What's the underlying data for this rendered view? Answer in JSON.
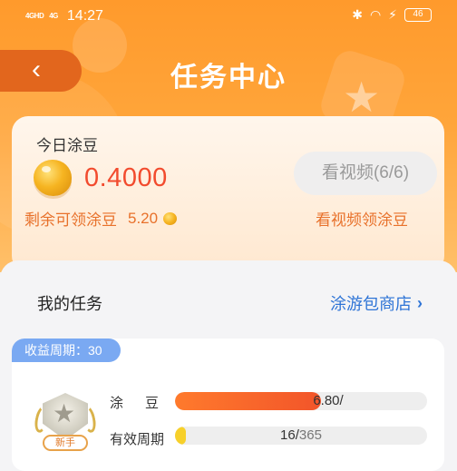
{
  "status_bar": {
    "signal_1": "4GHD",
    "signal_2": "4G",
    "time": "14:27",
    "battery": "46",
    "icons": [
      "bluetooth-icon",
      "wifi-icon",
      "charging-icon"
    ]
  },
  "header": {
    "title": "任务中心"
  },
  "earnings": {
    "today_label": "今日涂豆",
    "amount": "0.4000",
    "remaining_label": "剩余可领涂豆",
    "remaining_value": "5.20",
    "video_button": "看视频(6/6)",
    "video_link": "看视频领涂豆"
  },
  "tasks": {
    "title": "我的任务",
    "shop_link": "涂游包商店",
    "card": {
      "period_badge": "收益周期：30",
      "medal_label": "新手",
      "beans_label": "涂豆",
      "beans_current": "6.80",
      "beans_sep": "/",
      "beans_total": "",
      "beans_progress": 0.58,
      "period_label": "有效周期",
      "period_current": "16",
      "period_sep": "/",
      "period_total": "365",
      "period_progress": 0.044
    }
  },
  "colors": {
    "header_orange": "#ff9a2c",
    "amount_red": "#f24b2e",
    "accent_orange": "#e8712b",
    "link_blue": "#2e74d6",
    "badge_blue": "#7aa9f2"
  }
}
